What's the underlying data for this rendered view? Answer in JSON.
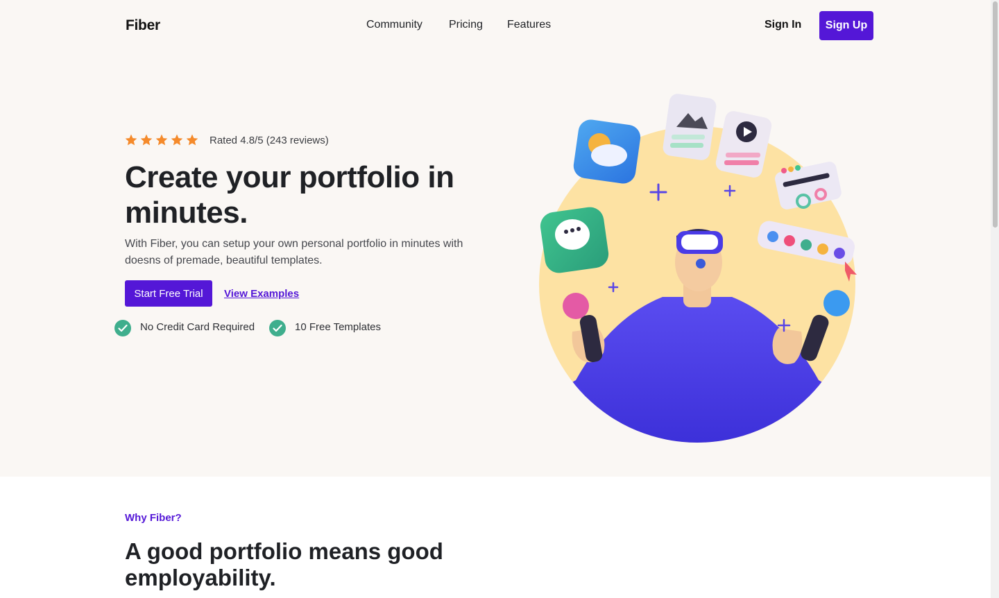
{
  "header": {
    "logo": "Fiber",
    "nav": [
      "Community",
      "Pricing",
      "Features"
    ],
    "sign_in": "Sign In",
    "sign_up": "Sign Up"
  },
  "hero": {
    "rating": {
      "stars": 5,
      "star_color": "#f58a2b",
      "text": "Rated 4.8/5 (243 reviews)"
    },
    "headline": "Create your portfolio in minutes.",
    "subtext": "With Fiber, you can setup your own personal portfolio in minutes with doesns of premade, beautiful templates.",
    "primary_cta": "Start Free Trial",
    "secondary_cta": "View Examples",
    "features": [
      "No Credit Card Required",
      "10 Free Templates"
    ],
    "check_icon_color": "#3fae8d"
  },
  "why": {
    "label": "Why Fiber?",
    "title": "A good portfolio means good employability."
  },
  "colors": {
    "accent": "#5417d7",
    "hero_background": "#faf7f4",
    "circle": "#fde2a3"
  }
}
